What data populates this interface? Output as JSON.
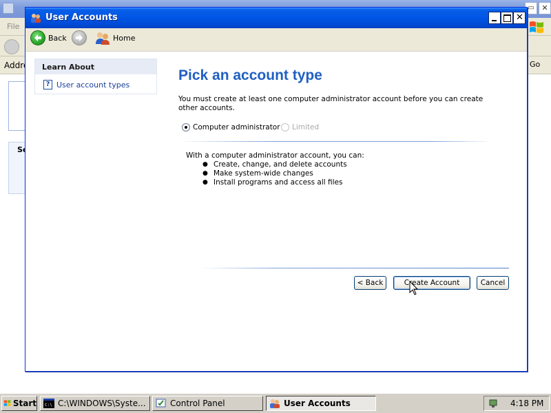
{
  "background_window": {
    "menu_file": "File",
    "address_label": "Addre",
    "go_label": "Go",
    "panel_heading_partial": "Se"
  },
  "window": {
    "title": "User Accounts"
  },
  "nav": {
    "back_label": "Back",
    "home_label": "Home"
  },
  "learn_about": {
    "header": "Learn About",
    "link": "User account types"
  },
  "main": {
    "heading": "Pick an account type",
    "description": "You must create at least one computer administrator account before you can create other accounts.",
    "options": [
      {
        "label": "Computer administrator",
        "selected": true,
        "enabled": true
      },
      {
        "label": "Limited",
        "selected": false,
        "enabled": false
      }
    ],
    "info_intro": "With a computer administrator account, you can:",
    "info_items": [
      "Create, change, and delete accounts",
      "Make system-wide changes",
      "Install programs and access all files"
    ]
  },
  "buttons": {
    "back": "< Back",
    "create": "Create Account",
    "cancel": "Cancel"
  },
  "taskbar": {
    "start": "Start",
    "tasks": [
      {
        "label": "C:\\WINDOWS\\Syste...",
        "icon": "cmd-icon",
        "active": false
      },
      {
        "label": "Control Panel",
        "icon": "control-panel-icon",
        "active": false
      },
      {
        "label": "User Accounts",
        "icon": "user-accounts-icon",
        "active": true
      }
    ],
    "clock": "4:18 PM"
  },
  "colors": {
    "titlebar_blue": "#0055e5",
    "heading_blue": "#1f5fc3",
    "link_blue": "#1a3f9a"
  }
}
